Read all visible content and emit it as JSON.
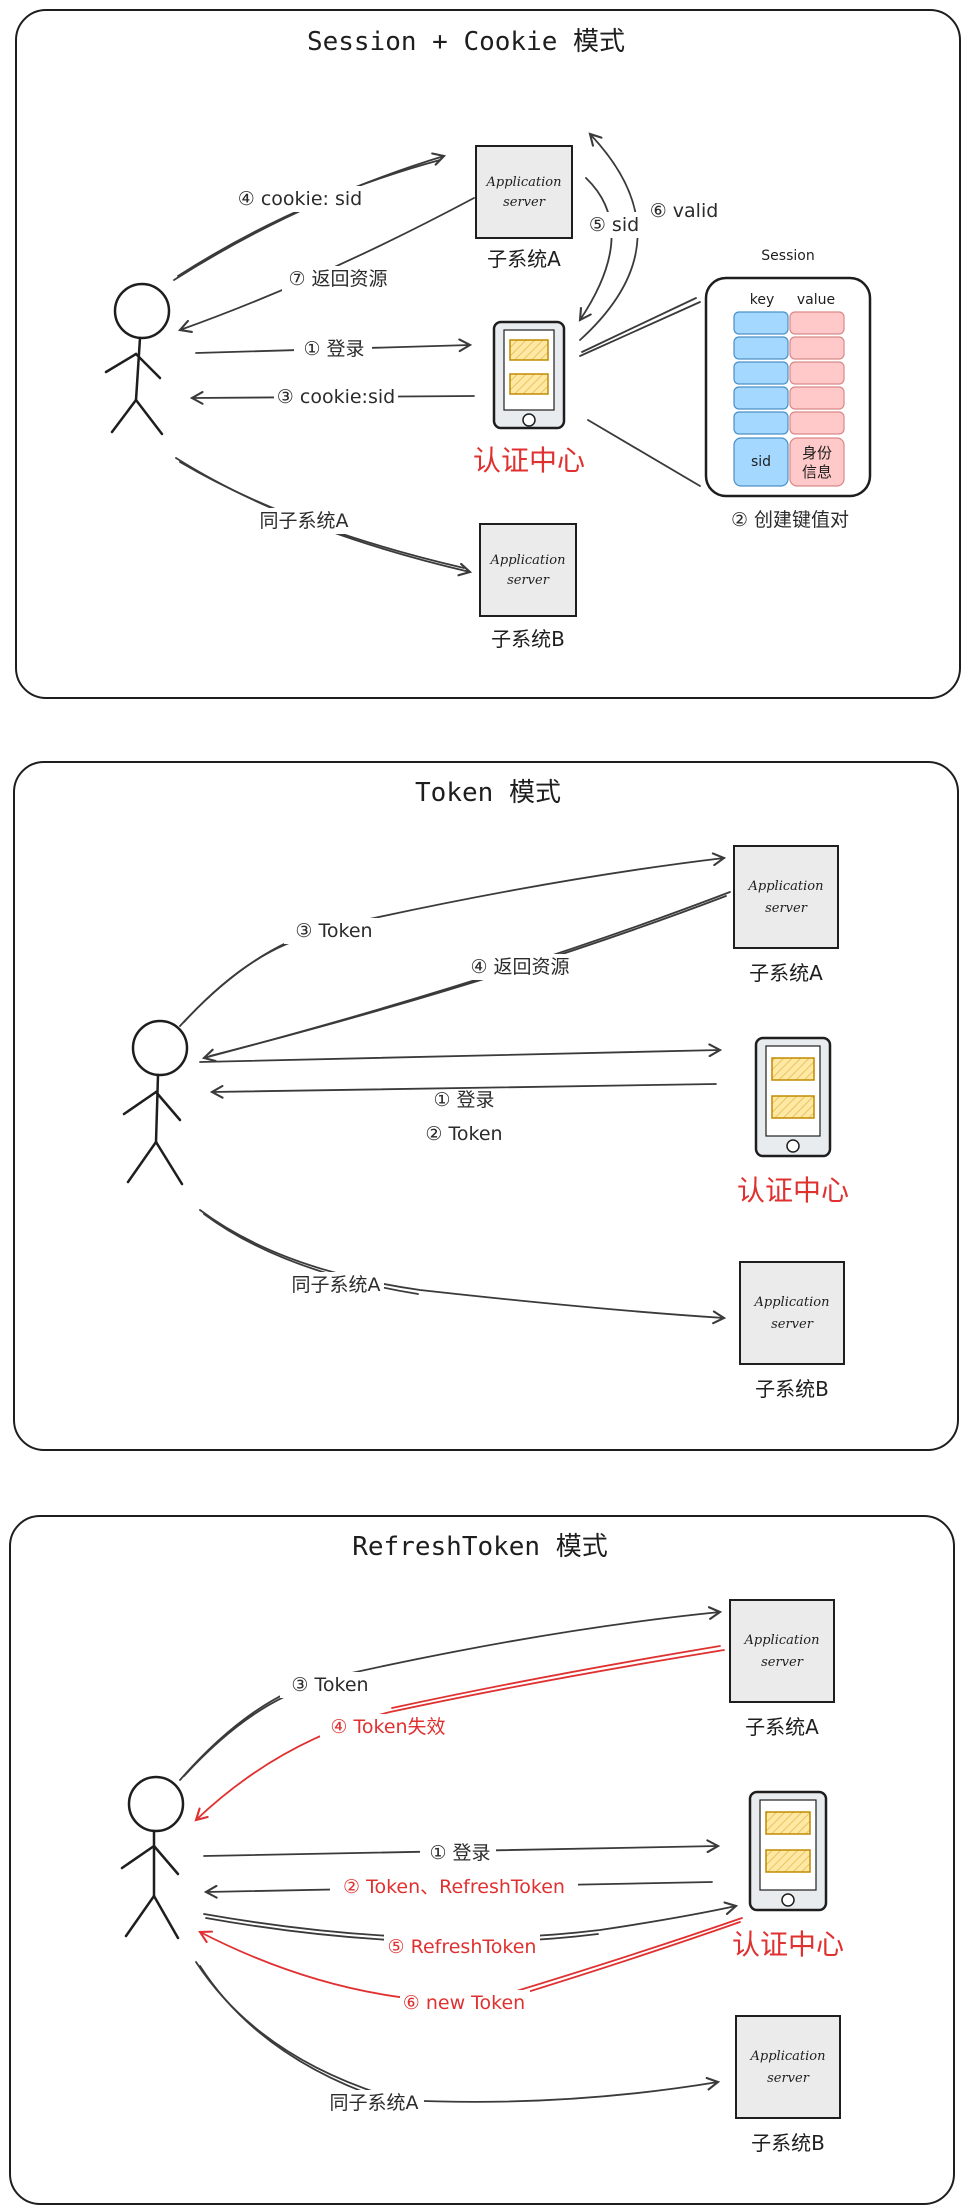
{
  "panels": [
    {
      "title": "Session + Cookie 模式",
      "server_text": [
        "Application",
        "server"
      ],
      "server_a_caption": "子系统A",
      "server_b_caption": "子系统B",
      "auth_caption": "认证中心",
      "labels": {
        "cookie_sid": "④ cookie: sid",
        "return_res": "⑦ 返回资源",
        "login": "① 登录",
        "cookie_sid2": "③ cookie:sid",
        "sid": "⑤ sid",
        "valid": "⑥ valid",
        "same_sub": "同子系统A",
        "create_kv": "② 创建键值对"
      },
      "session": {
        "title": "Session",
        "key_header": "key",
        "value_header": "value",
        "sid_cell": "sid",
        "identity_cell": [
          "身份",
          "信息"
        ]
      }
    },
    {
      "title": "Token 模式",
      "server_text": [
        "Application",
        "server"
      ],
      "server_a_caption": "子系统A",
      "server_b_caption": "子系统B",
      "auth_caption": "认证中心",
      "labels": {
        "token": "③ Token",
        "return_res": "④ 返回资源",
        "login": "① 登录",
        "token2": "② Token",
        "same_sub": "同子系统A"
      }
    },
    {
      "title": "RefreshToken 模式",
      "server_text": [
        "Application",
        "server"
      ],
      "server_a_caption": "子系统A",
      "server_b_caption": "子系统B",
      "auth_caption": "认证中心",
      "labels": {
        "token": "③ Token",
        "token_expired": "④ Token失效",
        "login": "① 登录",
        "token_refresh": "② Token、RefreshToken",
        "refresh": "⑤ RefreshToken",
        "new_token": "⑥ new Token",
        "same_sub": "同子系统A"
      }
    }
  ],
  "colors": {
    "stroke": "#1e1e1e",
    "arrow": "#3a3a3a",
    "red": "#e03131",
    "server_fill": "#ebebeb",
    "auth_fill": "#e9ecef",
    "screen_yellow": "#ffe8a3",
    "key_blue": "#a5d8ff",
    "value_pink": "#ffc9c9"
  }
}
